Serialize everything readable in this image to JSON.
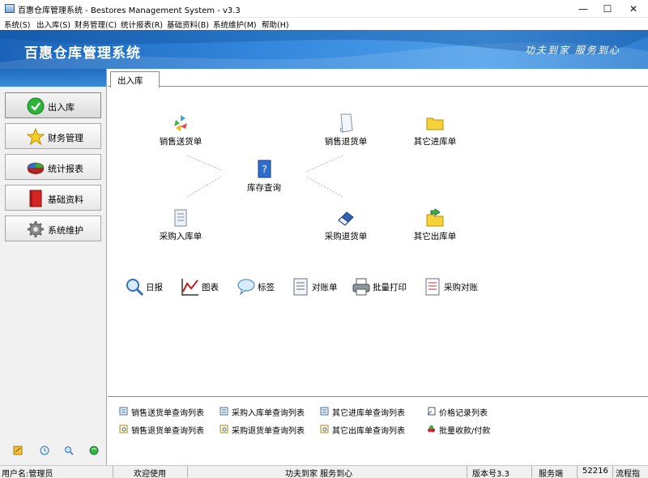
{
  "window": {
    "title": "百惠仓库管理系统 - Bestores Management System - v3.3",
    "minimize": "—",
    "maximize": "☐",
    "close": "✕"
  },
  "menu": [
    "系统(S)",
    "出入库(S)",
    "财务管理(C)",
    "统计报表(R)",
    "基础资料(B)",
    "系统维护(M)",
    "帮助(H)"
  ],
  "banner": {
    "app_title": "百惠仓库管理系统",
    "slogan": "功夫到家 服务到心"
  },
  "nav": {
    "items": [
      {
        "label": "出入库",
        "icon": "check-circle-icon",
        "active": true
      },
      {
        "label": "财务管理",
        "icon": "star-icon",
        "active": false
      },
      {
        "label": "统计报表",
        "icon": "pie-chart-icon",
        "active": false
      },
      {
        "label": "基础资料",
        "icon": "red-book-icon",
        "active": false
      },
      {
        "label": "系统维护",
        "icon": "gear-icon",
        "active": false
      }
    ]
  },
  "tab": {
    "label": "出入库"
  },
  "flow": {
    "sales_delivery": "销售送货单",
    "sales_return": "销售退货单",
    "other_in": "其它进库单",
    "inventory_query": "库存查询",
    "purchase_in": "采购入库单",
    "purchase_return": "采购退货单",
    "other_out": "其它出库单"
  },
  "tools": {
    "daily": "日报",
    "chart": "图表",
    "label": "标签",
    "statement": "对账单",
    "batch_print": "批量打印",
    "purchase_recon": "采购对账"
  },
  "queries": {
    "q1": "销售送货单查询列表",
    "q2": "采购入库单查询列表",
    "q3": "其它进库单查询列表",
    "q4": "价格记录列表",
    "q5": "销售退货单查询列表",
    "q6": "采购退货单查询列表",
    "q7": "其它出库单查询列表",
    "q8": "批量收款/付款"
  },
  "status": {
    "user": "用户名:管理员",
    "welcome": "欢迎使用",
    "motto": "功夫到家 服务到心",
    "version": "版本号3.3",
    "mode": "服务端",
    "port": "52216",
    "flow": "流程指"
  },
  "colors": {
    "banner": "#3387dc",
    "nav_header": "#1f6dc0"
  }
}
